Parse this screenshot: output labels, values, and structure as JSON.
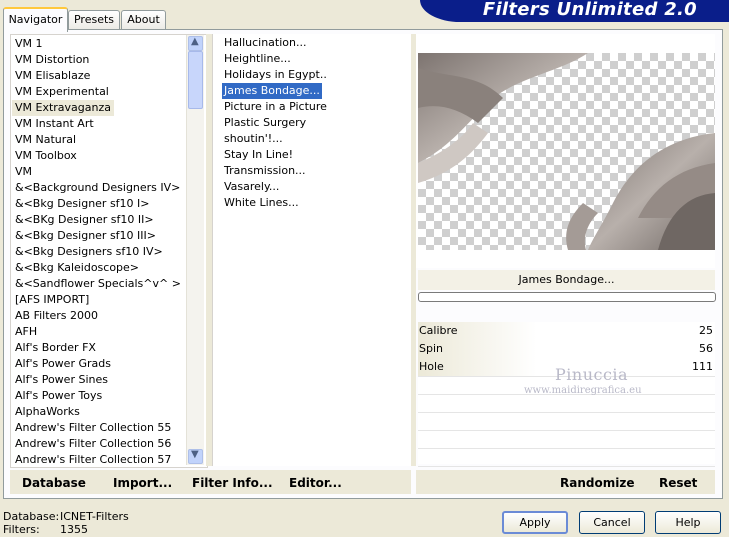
{
  "tabs": [
    {
      "label": "Navigator",
      "active": true
    },
    {
      "label": "Presets",
      "active": false
    },
    {
      "label": "About",
      "active": false
    }
  ],
  "banner": "Filters Unlimited 2.0",
  "categories": [
    "VM 1",
    "VM Distortion",
    "VM Elisablaze",
    "VM Experimental",
    "VM Extravaganza",
    "VM Instant Art",
    "VM Natural",
    "VM Toolbox",
    "VM",
    "&<Background Designers IV>",
    "&<Bkg Designer sf10 I>",
    "&<BKg Designer sf10 II>",
    "&<Bkg Designer sf10 III>",
    "&<Bkg Designers sf10 IV>",
    "&<Bkg Kaleidoscope>",
    "&<Sandflower Specials^v^ >",
    "[AFS IMPORT]",
    "AB Filters 2000",
    "AFH",
    "Alf's Border FX",
    "Alf's Power Grads",
    "Alf's Power Sines",
    "Alf's Power Toys",
    "AlphaWorks",
    "Andrew's Filter Collection 55",
    "Andrew's Filter Collection 56",
    "Andrew's Filter Collection 57"
  ],
  "selected_category": "VM Extravaganza",
  "filters": [
    "Hallucination...",
    "Heightline...",
    "Holidays in Egypt..",
    "James Bondage...",
    "Picture in a Picture",
    "Plastic Surgery",
    "shoutin'!...",
    "Stay In Line!",
    "Transmission...",
    "Vasarely...",
    "White Lines..."
  ],
  "selected_filter": "James Bondage...",
  "filter_name": "James Bondage...",
  "progress": 0,
  "params": [
    {
      "name": "Calibre",
      "value": "25"
    },
    {
      "name": "Spin",
      "value": "56"
    },
    {
      "name": "Hole",
      "value": "111"
    }
  ],
  "watermark": {
    "name": "Pinuccia",
    "site": "www.maidiregrafica.eu"
  },
  "left_buttons": {
    "database": "Database",
    "import": "Import...",
    "filter_info": "Filter Info...",
    "editor": "Editor..."
  },
  "right_buttons": {
    "randomize": "Randomize",
    "reset": "Reset"
  },
  "status": {
    "database_label": "Database:",
    "database_value": "ICNET-Filters",
    "filters_label": "Filters:",
    "filters_value": "1355"
  },
  "dialog_buttons": {
    "apply": "Apply",
    "cancel": "Cancel",
    "help": "Help"
  },
  "colors": {
    "selection": "#316ac5",
    "banner": "#0a1e8a",
    "tab_highlight": "#ffc83c"
  },
  "icons": {
    "scroll_up": "scroll-up-arrow-icon",
    "scroll_down": "scroll-down-arrow-icon"
  }
}
